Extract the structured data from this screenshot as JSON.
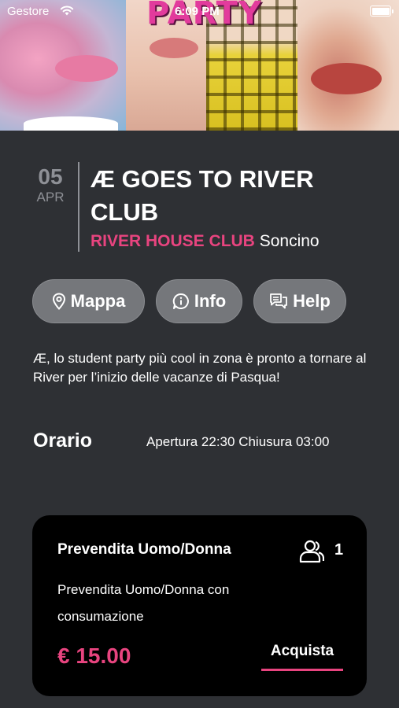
{
  "status_bar": {
    "carrier": "Gestore",
    "time": "6:09 PM"
  },
  "hero": {
    "logo_text": "PARTY"
  },
  "event": {
    "day": "05",
    "month": "APR",
    "title": "Æ GOES TO RIVER CLUB",
    "venue_name": "RIVER HOUSE CLUB",
    "venue_city": "Soncino"
  },
  "actions": {
    "map_label": "Mappa",
    "info_label": "Info",
    "help_label": "Help"
  },
  "description": "Æ, lo student party più cool in zona è pronto a tornare al River per l’inizio delle vacanze di Pasqua!",
  "schedule": {
    "label": "Orario",
    "hours": "Apertura 22:30  Chiusura 03:00"
  },
  "ticket": {
    "name": "Prevendita Uomo/Donna",
    "people_count": "1",
    "description": "Prevendita Uomo/Donna con consumazione",
    "price": "€ 15.00",
    "buy_label": "Acquista"
  },
  "colors": {
    "background": "#2e3034",
    "accent_pink": "#e8447f",
    "pill": "#75777b",
    "card": "#000000",
    "muted": "#8e9096"
  }
}
